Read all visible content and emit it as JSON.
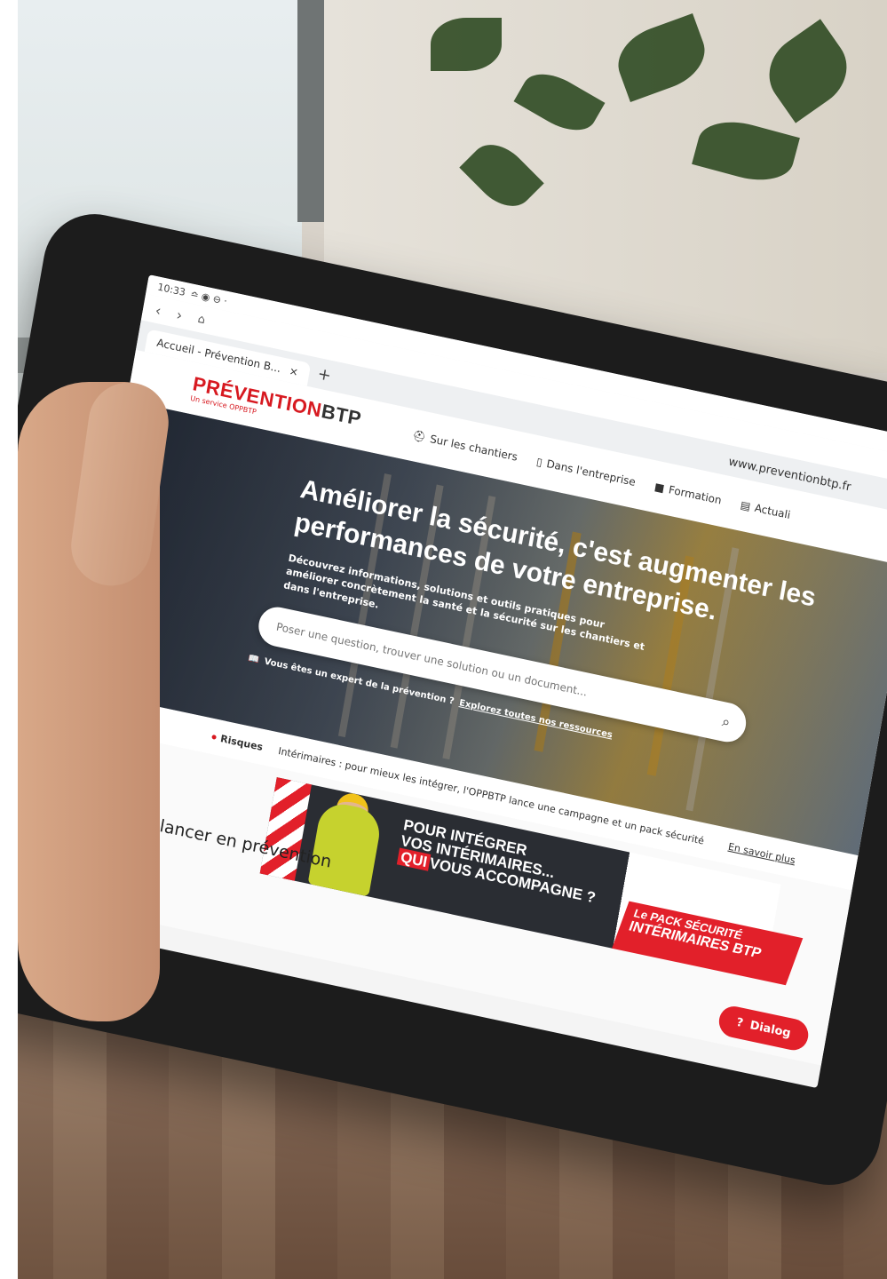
{
  "status": {
    "time": "10:33",
    "icons": "≏ ◉ ⊖ ·"
  },
  "browser": {
    "back_icon": "chevron-left-icon",
    "forward_icon": "chevron-right-icon",
    "tab_label": "Accueil - Prévention B...",
    "tab_close": "×",
    "new_tab": "+",
    "url": "www.preventionbtp.fr"
  },
  "site": {
    "logo": {
      "prefix": "PRÉVENTION",
      "suffix": "BTP",
      "tagline": "Un service OPPBTP"
    },
    "menu": [
      {
        "label": "Sur les chantiers",
        "icon": "helmet-icon"
      },
      {
        "label": "Dans l'entreprise",
        "icon": "clipboard-icon"
      },
      {
        "label": "Formation",
        "icon": "book-icon"
      },
      {
        "label": "Actuali",
        "icon": "news-icon"
      }
    ],
    "hero": {
      "title": "Améliorer la sécurité, c'est augmenter les performances de votre entreprise.",
      "subtitle": "Découvrez informations, solutions et outils pratiques pour améliorer concrètement la santé et la sécurité sur les chantiers et dans l'entreprise.",
      "search_placeholder": "Poser une question, trouver une solution ou un document...",
      "expert_text": "Vous êtes un expert de la prévention ?",
      "expert_link": "Explorez toutes nos ressources"
    },
    "news": {
      "tag": "Risques",
      "text": "Intérimaires : pour mieux les intégrer, l'OPPBTP lance une campagne et un pack sécurité",
      "link": "En savoir plus"
    },
    "banner": {
      "line1": "POUR INTÉGRER",
      "line2": "VOS INTÉRIMAIRES...",
      "line3_qui": "QUI",
      "line3_rest": "VOUS ACCOMPAGNE ?",
      "pack_line1": "Le PACK SÉCURITÉ",
      "pack_line2": "INTÉRIMAIRES BTP"
    },
    "section_title": "Se lancer en prévention",
    "chat_label": "Dialog"
  },
  "colors": {
    "brand_red": "#d71920",
    "banner_dark": "#2a2d33"
  }
}
